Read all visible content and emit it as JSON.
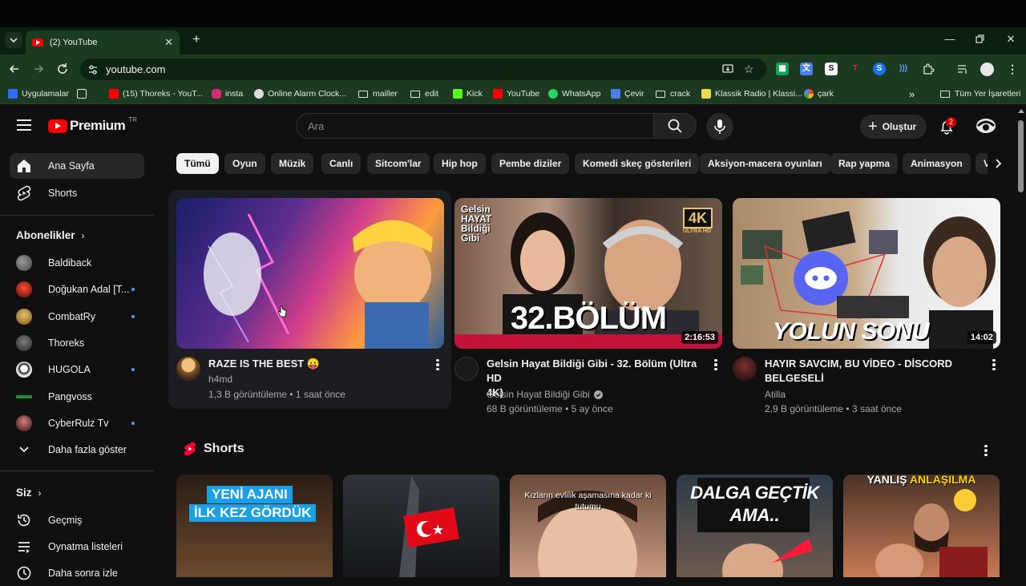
{
  "browser": {
    "tab_title": "(2) YouTube",
    "url": "youtube.com",
    "bookmarks": [
      {
        "label": "Uygulamalar",
        "icon": "apps-grid-icon"
      },
      {
        "label": "(15) Thoreks - YouT...",
        "icon": "youtube-icon"
      },
      {
        "label": "insta",
        "icon": "instagram-icon"
      },
      {
        "label": "Online Alarm Clock...",
        "icon": "clock-icon"
      },
      {
        "label": "mailler",
        "icon": "folder-icon"
      },
      {
        "label": "edit",
        "icon": "folder-icon"
      },
      {
        "label": "Kick",
        "icon": "kick-icon"
      },
      {
        "label": "YouTube",
        "icon": "youtube-icon"
      },
      {
        "label": "WhatsApp",
        "icon": "whatsapp-icon"
      },
      {
        "label": "Çevir",
        "icon": "translate-icon"
      },
      {
        "label": "crack",
        "icon": "folder-icon"
      },
      {
        "label": "Klassik Radio | Klassi...",
        "icon": "radio-icon"
      },
      {
        "label": "çark",
        "icon": "wheel-icon"
      }
    ],
    "all_bookmarks": "Tüm Yer İşaretleri"
  },
  "masthead": {
    "logo_text": "Premium",
    "region": "TR",
    "search_placeholder": "Ara",
    "create_label": "Oluştur",
    "notification_count": "2"
  },
  "sidebar": {
    "main": [
      {
        "label": "Ana Sayfa",
        "icon": "home-icon",
        "active": true
      },
      {
        "label": "Shorts",
        "icon": "shorts-icon",
        "active": false
      }
    ],
    "subscriptions_title": "Abonelikler",
    "subscriptions": [
      {
        "label": "Baldiback",
        "color": "#6b6b6b",
        "new": false
      },
      {
        "label": "Doğukan Adal [T...",
        "color": "#b22222",
        "new": true
      },
      {
        "label": "CombatRy",
        "color": "#c9a13c",
        "new": true
      },
      {
        "label": "Thoreks",
        "color": "#555555",
        "new": false
      },
      {
        "label": "HUGOLA",
        "color": "#e6e6e6",
        "new": true
      },
      {
        "label": "Pangvoss",
        "color": "#1f8f3a",
        "new": false
      },
      {
        "label": "CyberRulz Tv",
        "color": "#8a3d3d",
        "new": true
      }
    ],
    "show_more": "Daha fazla göster",
    "you_title": "Siz",
    "you_items": [
      {
        "label": "Geçmiş",
        "icon": "history-icon"
      },
      {
        "label": "Oynatma listeleri",
        "icon": "playlists-icon"
      },
      {
        "label": "Daha sonra izle",
        "icon": "watch-later-icon"
      }
    ]
  },
  "chips": [
    "Tümü",
    "Oyun",
    "Müzik",
    "Canlı",
    "Sitcom'lar",
    "Hip hop",
    "Pembe diziler",
    "Komedi skeç gösterileri",
    "Aksiyon-macera oyunları",
    "Rap yapma",
    "Animasyon"
  ],
  "videos": [
    {
      "title": "RAZE IS THE BEST 😛",
      "title2": "",
      "channel": "h4md",
      "verified": false,
      "meta": "1,3 B görüntüleme • 1 saat önce",
      "duration": "",
      "overlay_text": ""
    },
    {
      "title": "Gelsin Hayat Bildiği Gibi - 32. Bölüm (Ultra HD",
      "title2": "4K)",
      "channel": "Gelsin Hayat Bildiği Gibi",
      "verified": true,
      "meta": "68 B görüntüleme • 5 ay önce",
      "duration": "2:16:53",
      "overlay_text": "32.BÖLÜM",
      "badge": "4K",
      "badge_sub": "ULTRA HD",
      "logo_text": "Gelsin HAYAT Bildiği Gibi"
    },
    {
      "title": "HAYIR SAVCIM, BU VİDEO - DİSCORD",
      "title2": "BELGESELİ",
      "channel": "Atilla",
      "verified": false,
      "meta": "2,9 B görüntüleme • 3 saat önce",
      "duration": "14:02",
      "overlay_text": "YOLUN SONU"
    }
  ],
  "shorts": {
    "title": "Shorts",
    "items": [
      {
        "caption": "YENİ AJANI",
        "caption2": "İLK KEZ GÖRDÜK"
      },
      {
        "caption": "",
        "caption2": ""
      },
      {
        "caption": "Kızların evlilik aşamasına kadar ki",
        "caption2": "tutumu"
      },
      {
        "caption": "DALGA GEÇTİK",
        "caption2": "AMA.."
      },
      {
        "caption": "YANLIŞ",
        "caption2": "ANLAŞILMA"
      }
    ]
  }
}
